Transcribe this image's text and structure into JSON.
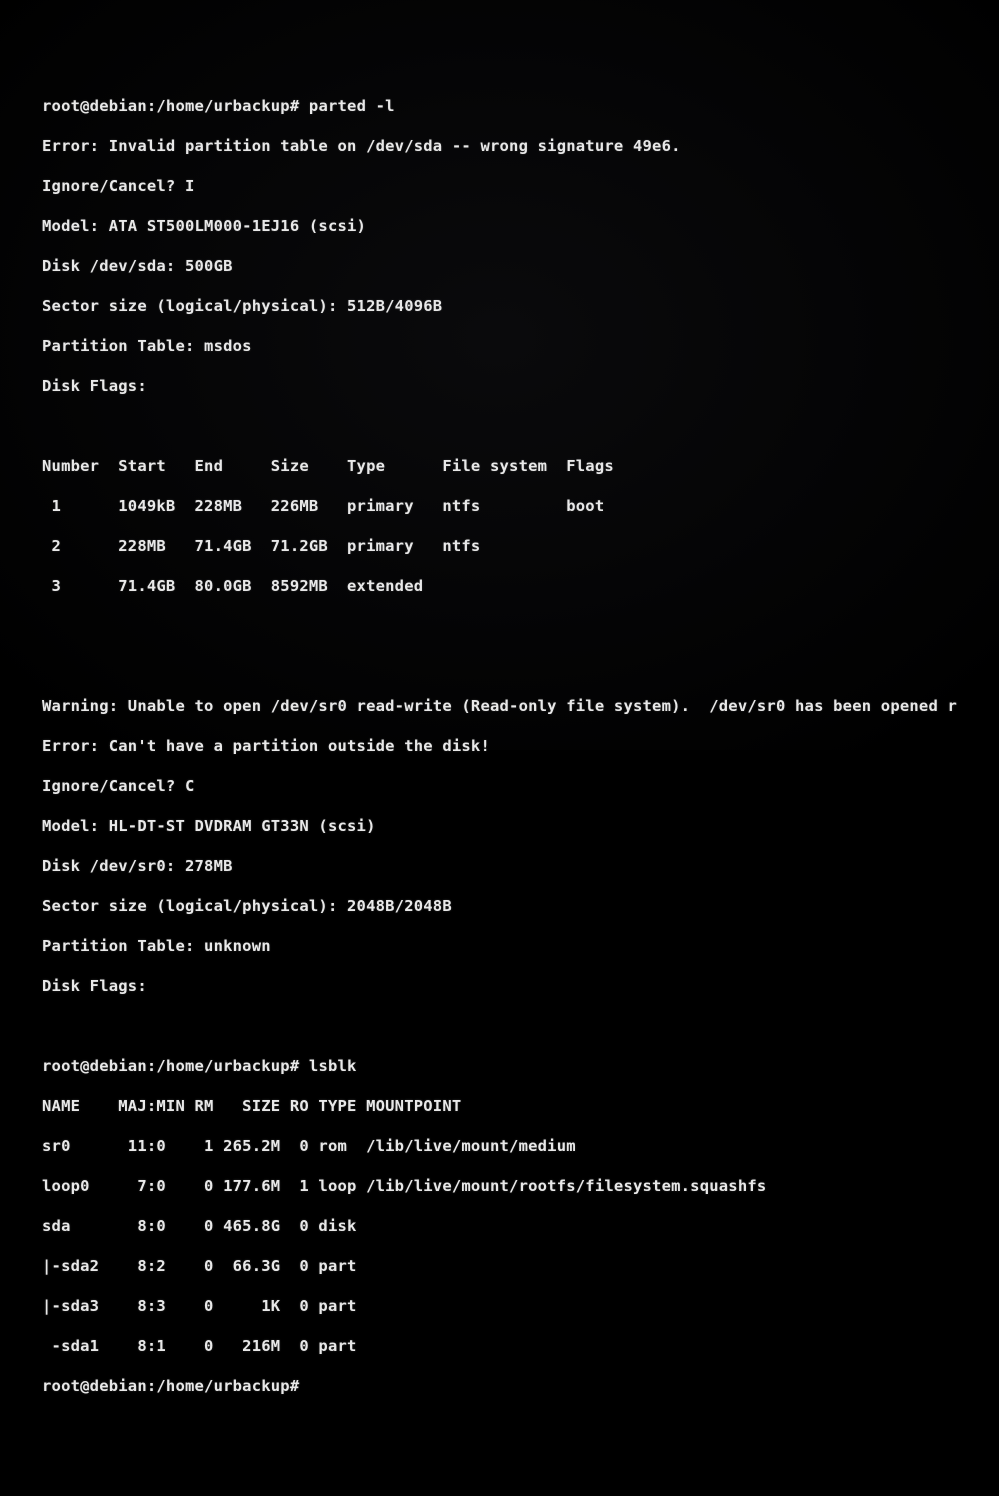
{
  "shell": {
    "prompt": "root@debian:/home/urbackup#",
    "cmd_parted": "parted -l",
    "cmd_lsblk": "lsblk"
  },
  "parted": {
    "sda": {
      "error": "Error: Invalid partition table on /dev/sda -- wrong signature 49e6.",
      "ignore": "Ignore/Cancel? I",
      "model": "Model: ATA ST500LM000-1EJ16 (scsi)",
      "disk": "Disk /dev/sda: 500GB",
      "sector": "Sector size (logical/physical): 512B/4096B",
      "ptable": "Partition Table: msdos",
      "flags": "Disk Flags:",
      "header": "Number  Start   End     Size    Type      File system  Flags",
      "rows": [
        " 1      1049kB  228MB   226MB   primary   ntfs         boot",
        " 2      228MB   71.4GB  71.2GB  primary   ntfs",
        " 3      71.4GB  80.0GB  8592MB  extended"
      ]
    },
    "sr0": {
      "warn": "Warning: Unable to open /dev/sr0 read-write (Read-only file system).  /dev/sr0 has been opened r",
      "error": "Error: Can't have a partition outside the disk!",
      "ignore": "Ignore/Cancel? C",
      "model": "Model: HL-DT-ST DVDRAM GT33N (scsi)",
      "disk": "Disk /dev/sr0: 278MB",
      "sector": "Sector size (logical/physical): 2048B/2048B",
      "ptable": "Partition Table: unknown",
      "flags": "Disk Flags:"
    }
  },
  "lsblk": {
    "header": "NAME    MAJ:MIN RM   SIZE RO TYPE MOUNTPOINT",
    "rows": [
      "sr0      11:0    1 265.2M  0 rom  /lib/live/mount/medium",
      "loop0     7:0    0 177.6M  1 loop /lib/live/mount/rootfs/filesystem.squashfs",
      "sda       8:0    0 465.8G  0 disk",
      "|-sda2    8:2    0  66.3G  0 part",
      "|-sda3    8:3    0     1K  0 part",
      " -sda1    8:1    0   216M  0 part"
    ]
  },
  "chart_data": {
    "type": "table",
    "title": "lsblk block devices",
    "columns": [
      "NAME",
      "MAJ:MIN",
      "RM",
      "SIZE",
      "RO",
      "TYPE",
      "MOUNTPOINT"
    ],
    "rows": [
      [
        "sr0",
        "11:0",
        1,
        "265.2M",
        0,
        "rom",
        "/lib/live/mount/medium"
      ],
      [
        "loop0",
        "7:0",
        0,
        "177.6M",
        1,
        "loop",
        "/lib/live/mount/rootfs/filesystem.squashfs"
      ],
      [
        "sda",
        "8:0",
        0,
        "465.8G",
        0,
        "disk",
        ""
      ],
      [
        "sda2",
        "8:2",
        0,
        "66.3G",
        0,
        "part",
        ""
      ],
      [
        "sda3",
        "8:3",
        0,
        "1K",
        0,
        "part",
        ""
      ],
      [
        "sda1",
        "8:1",
        0,
        "216M",
        0,
        "part",
        ""
      ]
    ]
  }
}
